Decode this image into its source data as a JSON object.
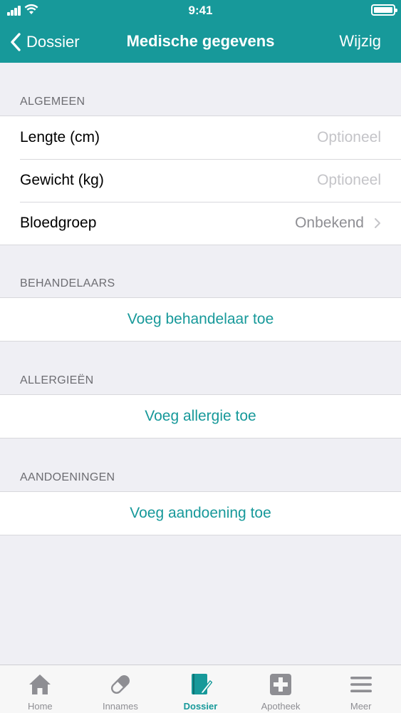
{
  "status": {
    "time": "9:41"
  },
  "nav": {
    "back_label": "Dossier",
    "title": "Medische gegevens",
    "edit_label": "Wijzig"
  },
  "sections": {
    "general": {
      "header": "ALGEMEEN",
      "rows": [
        {
          "label": "Lengte (cm)",
          "placeholder": "Optioneel"
        },
        {
          "label": "Gewicht (kg)",
          "placeholder": "Optioneel"
        },
        {
          "label": "Bloedgroep",
          "value": "Onbekend"
        }
      ]
    },
    "practitioners": {
      "header": "BEHANDELAARS",
      "action": "Voeg behandelaar toe"
    },
    "allergies": {
      "header": "ALLERGIEËN",
      "action": "Voeg allergie toe"
    },
    "conditions": {
      "header": "AANDOENINGEN",
      "action": "Voeg aandoening toe"
    }
  },
  "tabs": [
    {
      "label": "Home",
      "icon": "home-icon"
    },
    {
      "label": "Innames",
      "icon": "pill-icon"
    },
    {
      "label": "Dossier",
      "icon": "dossier-icon",
      "active": true
    },
    {
      "label": "Apotheek",
      "icon": "pharmacy-cross-icon"
    },
    {
      "label": "Meer",
      "icon": "menu-icon"
    }
  ],
  "colors": {
    "accent": "#17999a",
    "background": "#efeff4",
    "placeholder": "#c4c4c8"
  }
}
